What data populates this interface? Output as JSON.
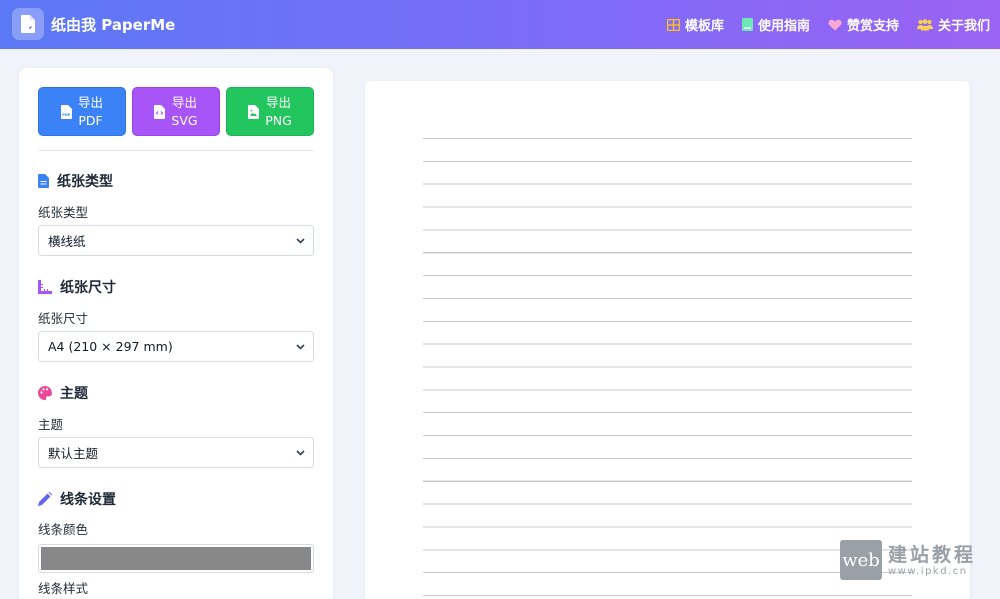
{
  "header": {
    "brand": "纸由我 PaperMe",
    "nav": [
      {
        "label": "模板库",
        "icon": "grid-icon",
        "color": "#fbbf24"
      },
      {
        "label": "使用指南",
        "icon": "book-icon",
        "color": "#6ee7b7"
      },
      {
        "label": "赞赏支持",
        "icon": "heart-icon",
        "color": "#f9a8d4"
      },
      {
        "label": "关于我们",
        "icon": "users-icon",
        "color": "#fcd34d"
      }
    ]
  },
  "export": {
    "pdf": {
      "line1": "导出",
      "line2": "PDF"
    },
    "svg": {
      "line1": "导出",
      "line2": "SVG"
    },
    "png": {
      "line1": "导出",
      "line2": "PNG"
    }
  },
  "sections": {
    "paper_type": {
      "title": "纸张类型",
      "label": "纸张类型",
      "value": "横线纸",
      "icon": "file-icon",
      "color": "#3b82f6"
    },
    "paper_size": {
      "title": "纸张尺寸",
      "label": "纸张尺寸",
      "value": "A4 (210 × 297 mm)",
      "icon": "ruler-icon",
      "color": "#a855f7"
    },
    "theme": {
      "title": "主题",
      "label": "主题",
      "value": "默认主题",
      "icon": "palette-icon",
      "color": "#ec4899"
    },
    "line_settings": {
      "title": "线条设置",
      "icon": "pencil-icon",
      "color": "#6366f1"
    },
    "line_color": {
      "label": "线条颜色",
      "value": "#888888"
    },
    "line_style": {
      "label": "线条样式"
    }
  },
  "watermark": {
    "box": "web",
    "cn": "建站教程",
    "url": "www.ipkd.cn"
  }
}
